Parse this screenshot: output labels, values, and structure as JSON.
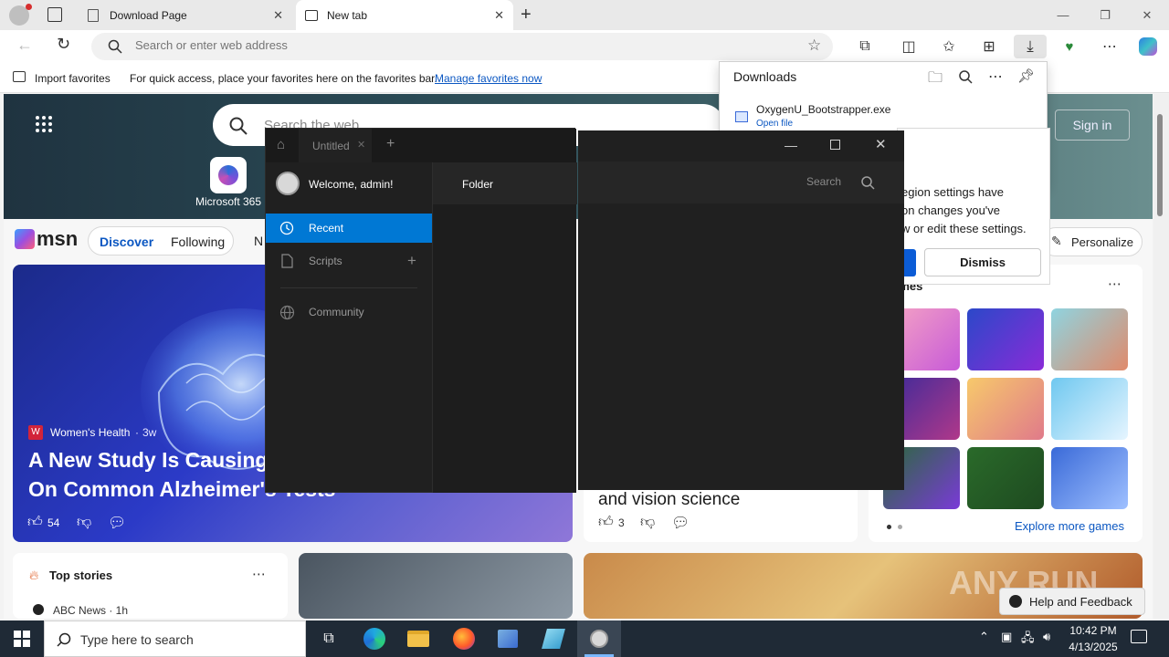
{
  "browser": {
    "tabs": [
      {
        "label": "Download Page"
      },
      {
        "label": "New tab"
      }
    ],
    "address_placeholder": "Search or enter web address",
    "favorites_bar": {
      "import_label": "Import favorites",
      "hint": "For quick access, place your favorites here on the favorites bar.",
      "manage_link": "Manage favorites now"
    }
  },
  "downloads": {
    "title": "Downloads",
    "file_name": "OxygenU_Bootstrapper.exe",
    "open_file": "Open file",
    "partial_name": "xe"
  },
  "notice": {
    "line1": "egion settings have",
    "line2": "on changes you've",
    "line3": "w or edit these settings.",
    "dismiss": "Dismiss"
  },
  "msn": {
    "search_placeholder": "Search the web",
    "signin": "Sign in",
    "app_label": "Microsoft 365",
    "logo": "msn",
    "tabs": [
      "Discover",
      "Following",
      "N"
    ],
    "personalize": "Personalize",
    "hero_source": "Women's Health",
    "hero_age": "3w",
    "hero_title_line1": "A New Study Is Causing",
    "hero_title_line2": "On Common Alzheimer's Tests",
    "hero_likes": "54",
    "card2_title": "and vision science",
    "card2_likes": "3",
    "games_title": "Games",
    "explore_games": "Explore more games",
    "top_stories": "Top stories",
    "news_source": "ABC News · 1h",
    "help_feedback": "Help and Feedback",
    "watermark": "ANY RUN"
  },
  "app": {
    "tab_title": "Untitled",
    "welcome": "Welcome, admin!",
    "folder": "Folder",
    "search": "Search",
    "menu": [
      {
        "label": "Recent"
      },
      {
        "label": "Scripts"
      },
      {
        "label": "Community"
      }
    ]
  },
  "taskbar": {
    "search_placeholder": "Type here to search",
    "time": "10:42 PM",
    "date": "4/13/2025"
  },
  "colors": {
    "accent": "#0078d4",
    "app_bg": "#202020",
    "taskbar": "#1f2a36"
  }
}
